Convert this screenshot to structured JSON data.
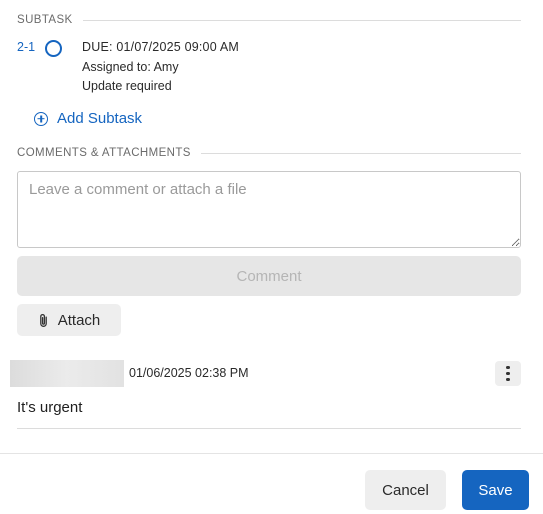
{
  "subtask_section": {
    "title": "SUBTASK",
    "items": [
      {
        "id": "2-1",
        "due": "DUE: 01/07/2025 09:00 AM",
        "assigned": "Assigned to: Amy",
        "note": "Update required"
      }
    ],
    "add_label": "Add Subtask"
  },
  "comments_section": {
    "title": "COMMENTS & ATTACHMENTS",
    "input_placeholder": "Leave a comment or attach a file",
    "input_value": "",
    "comment_button": "Comment",
    "attach_button": "Attach",
    "comments": [
      {
        "timestamp": "01/06/2025 02:38 PM",
        "text": "It's urgent"
      }
    ]
  },
  "footer": {
    "cancel_label": "Cancel",
    "save_label": "Save"
  },
  "colors": {
    "accent": "#1565c0",
    "disabled_button": "#e6e6e6",
    "secondary_button": "#eeeeee"
  },
  "icons": {
    "subtask_status": "circle-icon",
    "add": "plus-circle-icon",
    "attach": "paperclip-icon",
    "more": "more-vertical-icon"
  }
}
